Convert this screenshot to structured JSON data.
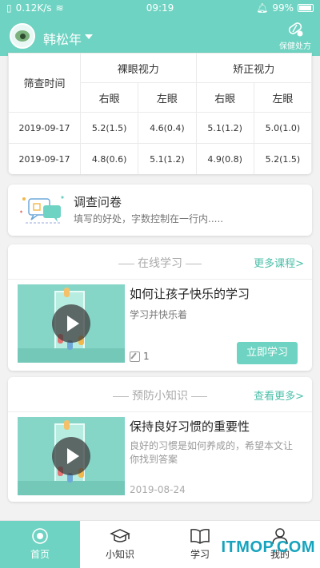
{
  "status_bar": {
    "network": "0.12K/s",
    "time": "09:19",
    "battery": "99%"
  },
  "header": {
    "user_name": "韩松年",
    "care_label": "保健处方"
  },
  "vision_table": {
    "col_time": "筛查时间",
    "group_naked": "裸眼视力",
    "group_corrected": "矫正视力",
    "right_eye": "右眼",
    "left_eye": "左眼",
    "rows": [
      {
        "date": "2019-09-17",
        "naked_right": "5.2(1.5)",
        "naked_left": "4.6(0.4)",
        "corr_right": "5.1(1.2)",
        "corr_left": "5.0(1.0)"
      },
      {
        "date": "2019-09-17",
        "naked_right": "4.8(0.6)",
        "naked_left": "5.1(1.2)",
        "corr_right": "4.9(0.8)",
        "corr_left": "5.2(1.5)"
      }
    ]
  },
  "survey": {
    "title": "调查问卷",
    "desc": "填写的好处，字数控制在一行内....."
  },
  "online_study": {
    "section_title": "在线学习",
    "more": "更多课程>",
    "item": {
      "title": "如何让孩子快乐的学习",
      "subtitle": "学习并快乐着",
      "count": "1",
      "button": "立即学习"
    }
  },
  "prevention": {
    "section_title": "预防小知识",
    "more": "查看更多>",
    "item": {
      "title": "保持良好习惯的重要性",
      "desc": "良好的习惯是如何养成的，希望本文让你找到答案",
      "date": "2019-08-24"
    }
  },
  "tabs": [
    {
      "label": "首页",
      "icon": "eye-icon"
    },
    {
      "label": "小知识",
      "icon": "graduation-cap-icon"
    },
    {
      "label": "学习",
      "icon": "book-icon"
    },
    {
      "label": "我的",
      "icon": "user-icon"
    }
  ],
  "watermark": "ITMOP.COM",
  "colors": {
    "accent": "#6ed3c2",
    "link": "#4bbfa9"
  }
}
